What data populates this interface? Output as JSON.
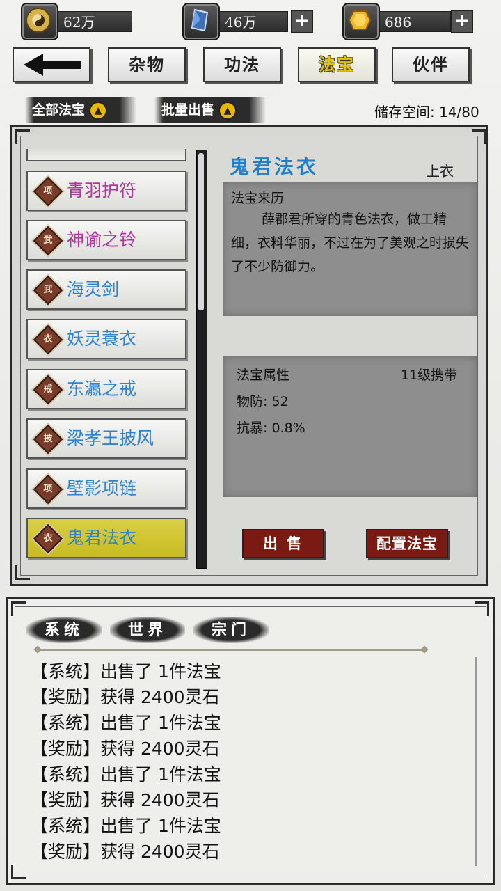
{
  "currency": [
    {
      "icon": "yin-yang-icon",
      "value": "62万",
      "has_plus": false
    },
    {
      "icon": "blue-crystal-icon",
      "value": "46万",
      "has_plus": true
    },
    {
      "icon": "gold-gem-icon",
      "value": "686",
      "has_plus": true
    }
  ],
  "plus_label": "+",
  "tabs": {
    "back_icon": "arrow-left-icon",
    "items": [
      {
        "label": "杂物",
        "active": false
      },
      {
        "label": "功法",
        "active": false
      },
      {
        "label": "法宝",
        "active": true
      },
      {
        "label": "伙伴",
        "active": false
      }
    ]
  },
  "filters": {
    "all_label": "全部法宝",
    "batch_sell_label": "批量出售",
    "storage_label": "储存空间: 14/80"
  },
  "items": [
    {
      "type": "项",
      "name": "青羽护符",
      "color": "#b0379c",
      "selected": false
    },
    {
      "type": "武",
      "name": "神谕之铃",
      "color": "#b0379c",
      "selected": false
    },
    {
      "type": "武",
      "name": "海灵剑",
      "color": "#2e82d0",
      "selected": false
    },
    {
      "type": "衣",
      "name": "妖灵蓑衣",
      "color": "#2e82d0",
      "selected": false
    },
    {
      "type": "戒",
      "name": "东瀛之戒",
      "color": "#2e82d0",
      "selected": false
    },
    {
      "type": "披",
      "name": "梁孝王披风",
      "color": "#2e82d0",
      "selected": false
    },
    {
      "type": "项",
      "name": "壁影项链",
      "color": "#2e82d0",
      "selected": false
    },
    {
      "type": "衣",
      "name": "鬼君法衣",
      "color": "#2e82d0",
      "selected": true
    }
  ],
  "detail": {
    "title": "鬼君法衣",
    "slot": "上衣",
    "origin_heading": "法宝来历",
    "origin_text": "薛郡君所穿的青色法衣，做工精细，衣料华丽，不过在为了美观之时损失了不少防御力。",
    "attr_heading": "法宝属性",
    "level_req": "11级携带",
    "attrs": [
      "物防: 52",
      "抗暴: 0.8%"
    ]
  },
  "actions": {
    "sell": "出 售",
    "equip": "配置法宝"
  },
  "chat": {
    "tabs": [
      "系统",
      "世界",
      "宗门"
    ],
    "messages": [
      "【系统】出售了 1件法宝",
      "【奖励】获得 2400灵石",
      "【系统】出售了 1件法宝",
      "【奖励】获得 2400灵石",
      "【系统】出售了 1件法宝",
      "【奖励】获得 2400灵石",
      "【系统】出售了 1件法宝",
      "【奖励】获得 2400灵石"
    ]
  }
}
